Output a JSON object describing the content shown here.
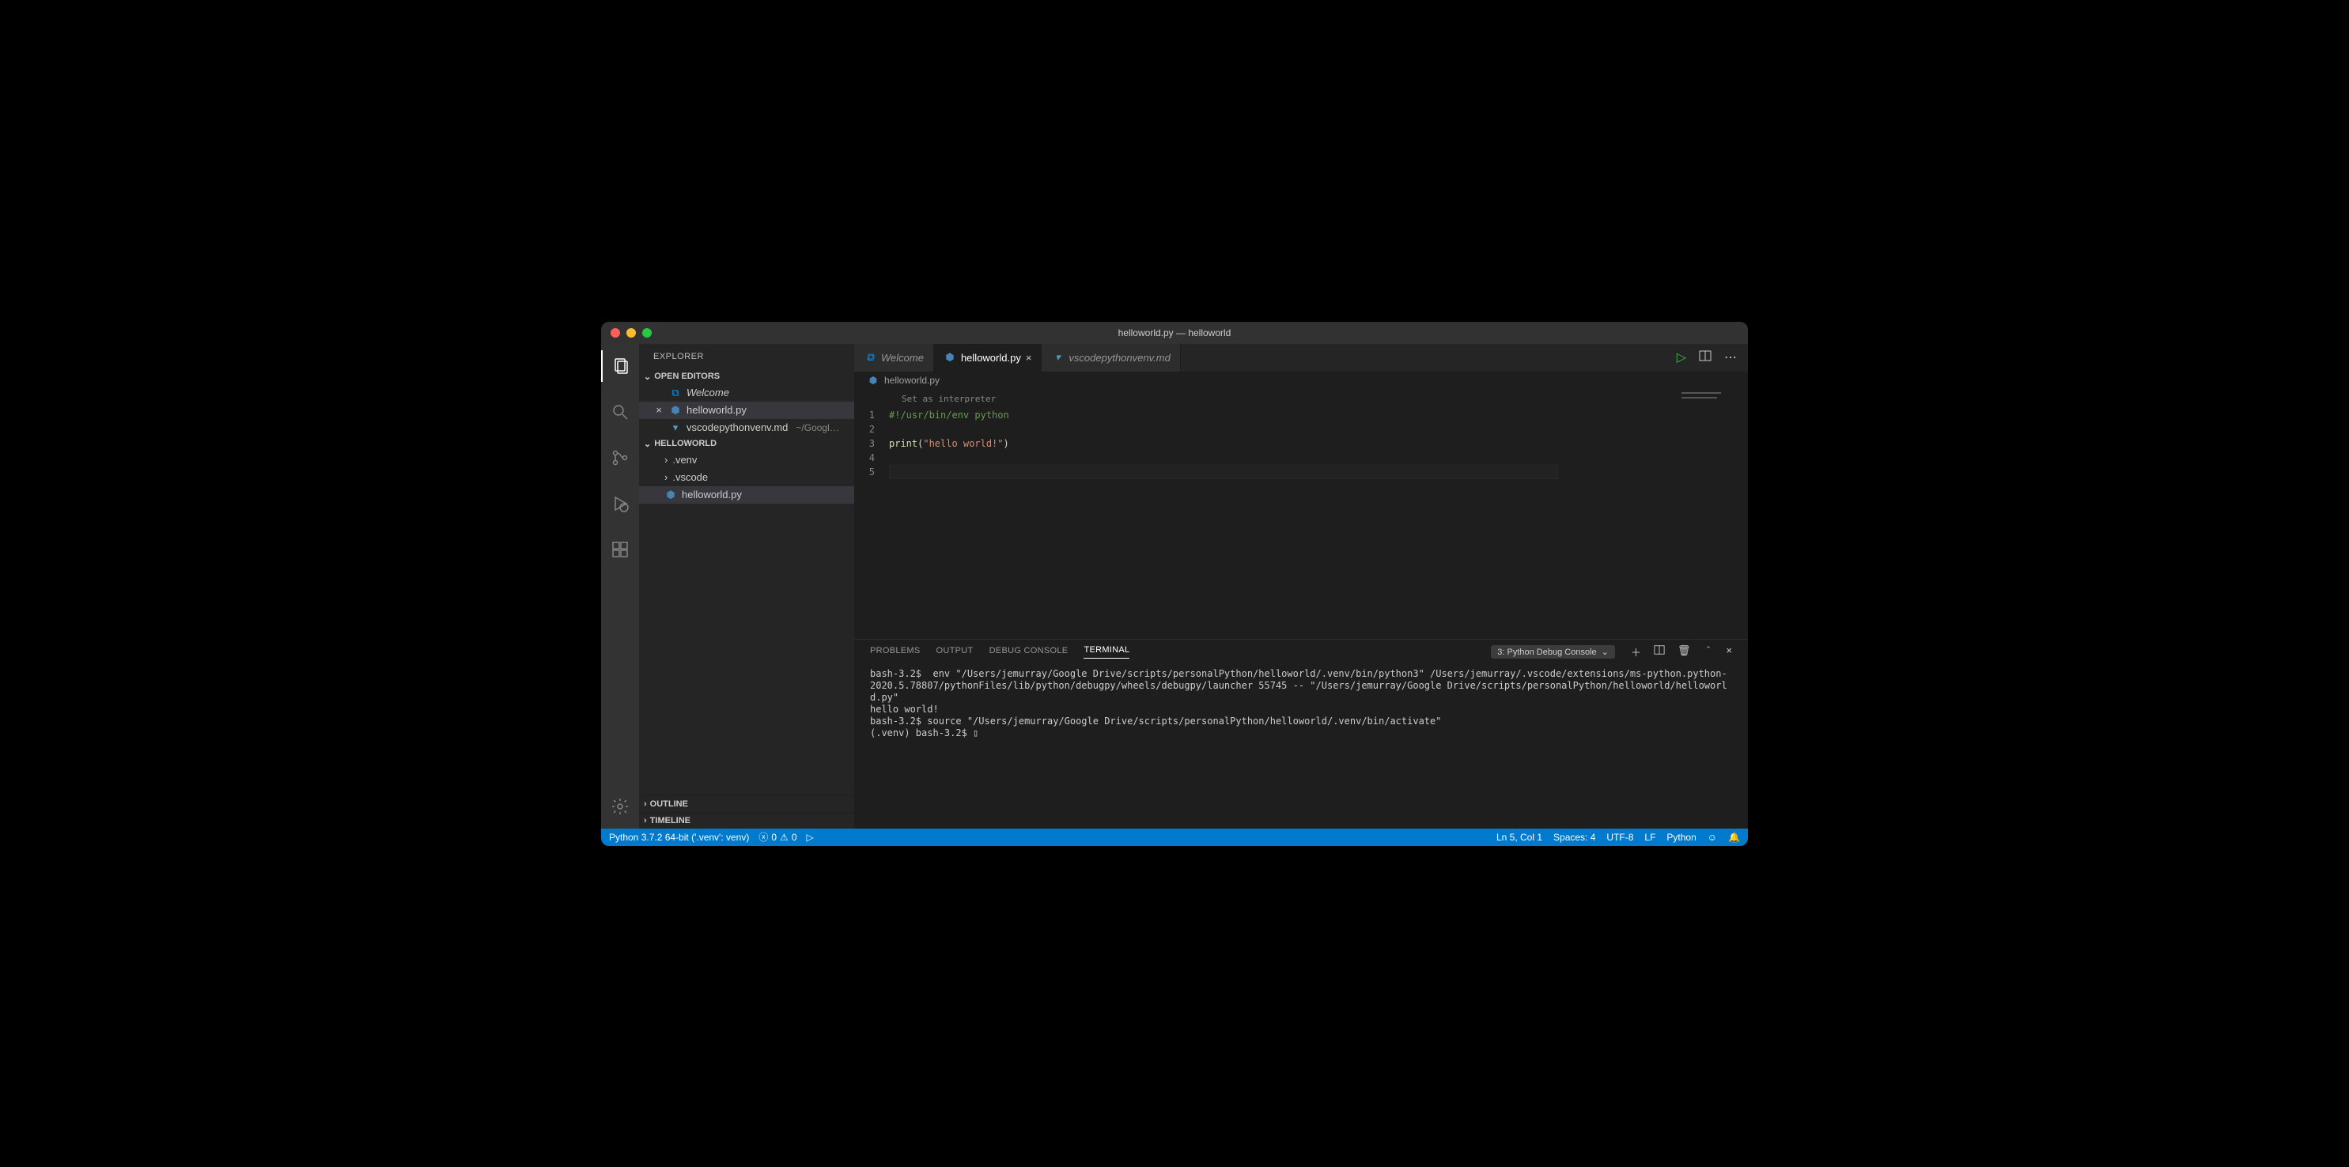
{
  "window": {
    "title": "helloworld.py — helloworld"
  },
  "sidebar": {
    "title": "EXPLORER",
    "open_editors_label": "OPEN EDITORS",
    "open_editors": [
      {
        "label": "Welcome",
        "icon": "vscode",
        "italic": true
      },
      {
        "label": "helloworld.py",
        "icon": "python",
        "active": true
      },
      {
        "label": "vscodepythonvenv.md",
        "icon": "markdown",
        "path": "~/Googl…"
      }
    ],
    "workspace_label": "HELLOWORLD",
    "files": [
      {
        "label": ".venv",
        "kind": "folder"
      },
      {
        "label": ".vscode",
        "kind": "folder"
      },
      {
        "label": "helloworld.py",
        "kind": "python",
        "selected": true
      }
    ],
    "outline_label": "OUTLINE",
    "timeline_label": "TIMELINE"
  },
  "tabs": [
    {
      "label": "Welcome",
      "icon": "vscode",
      "italic": true
    },
    {
      "label": "helloworld.py",
      "icon": "python",
      "active": true,
      "close": true
    },
    {
      "label": "vscodepythonvenv.md",
      "icon": "markdown",
      "italic": true
    }
  ],
  "breadcrumb": {
    "file": "helloworld.py"
  },
  "hint": "Set as interpreter",
  "code": {
    "lines": [
      "1",
      "2",
      "3",
      "4",
      "5"
    ],
    "l1_comment": "#!/usr/bin/env python",
    "l3_func": "print",
    "l3_open": "(",
    "l3_str": "\"hello world!\"",
    "l3_close": ")"
  },
  "panel": {
    "tabs": [
      "PROBLEMS",
      "OUTPUT",
      "DEBUG CONSOLE",
      "TERMINAL"
    ],
    "active_tab": "TERMINAL",
    "terminal_selector": "3: Python Debug Console",
    "terminal_text": "bash-3.2$  env \"/Users/jemurray/Google Drive/scripts/personalPython/helloworld/.venv/bin/python3\" /Users/jemurray/.vscode/extensions/ms-python.python-2020.5.78807/pythonFiles/lib/python/debugpy/wheels/debugpy/launcher 55745 -- \"/Users/jemurray/Google Drive/scripts/personalPython/helloworld/helloworld.py\"\nhello world!\nbash-3.2$ source \"/Users/jemurray/Google Drive/scripts/personalPython/helloworld/.venv/bin/activate\"\n(.venv) bash-3.2$ ▯"
  },
  "statusbar": {
    "python": "Python 3.7.2 64-bit ('.venv': venv)",
    "errors": "0",
    "warnings": "0",
    "ln_col": "Ln 5, Col 1",
    "spaces": "Spaces: 4",
    "encoding": "UTF-8",
    "eol": "LF",
    "lang": "Python"
  }
}
